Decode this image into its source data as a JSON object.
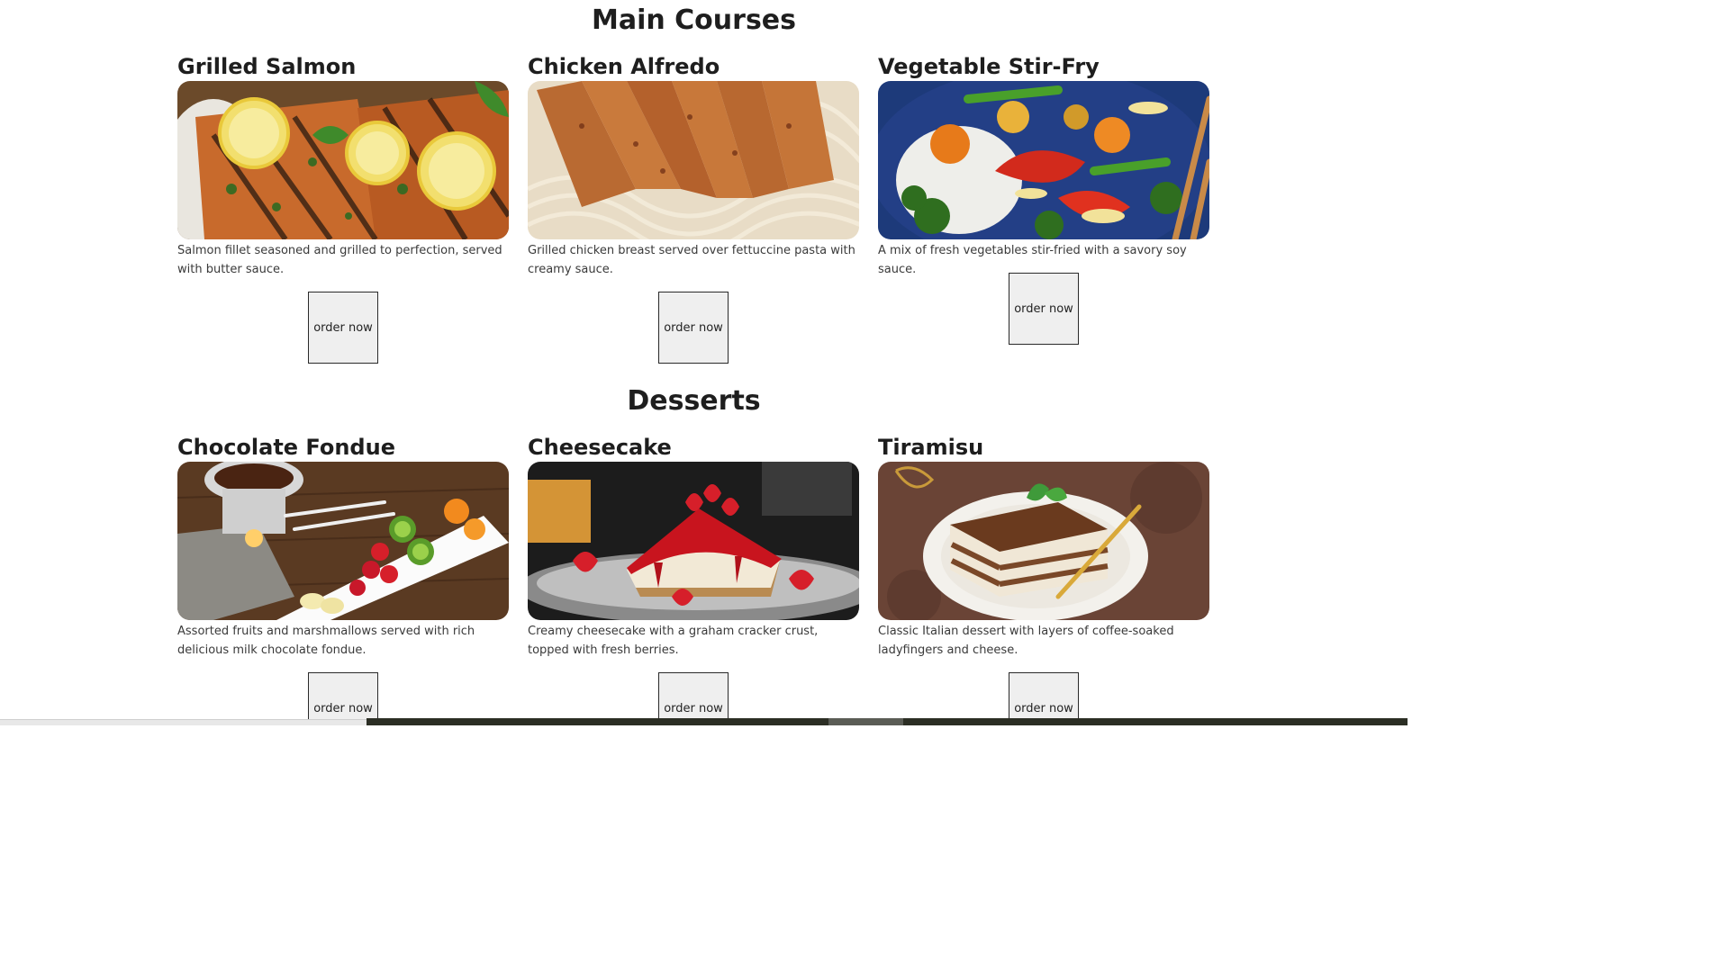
{
  "main_courses": {
    "heading": "Main Courses",
    "items": [
      {
        "name": "Grilled Salmon",
        "description": "Salmon fillet seasoned and grilled to perfection, served with butter sauce.",
        "button": "order now"
      },
      {
        "name": "Chicken Alfredo",
        "description": "Grilled chicken breast served over fettuccine pasta with creamy sauce.",
        "button": "order now"
      },
      {
        "name": "Vegetable Stir-Fry",
        "description": "A mix of fresh vegetables stir-fried with a savory soy sauce.",
        "button": "order now"
      }
    ]
  },
  "desserts": {
    "heading": "Desserts",
    "items": [
      {
        "name": "Chocolate Fondue",
        "description": "Assorted fruits and marshmallows served with rich delicious milk chocolate fondue.",
        "button": "order now"
      },
      {
        "name": "Cheesecake",
        "description": "Creamy cheesecake with a graham cracker crust, topped with fresh berries.",
        "button": "order now"
      },
      {
        "name": "Tiramisu",
        "description": "Classic Italian dessert with layers of coffee-soaked ladyfingers and cheese.",
        "button": "order now"
      }
    ]
  }
}
